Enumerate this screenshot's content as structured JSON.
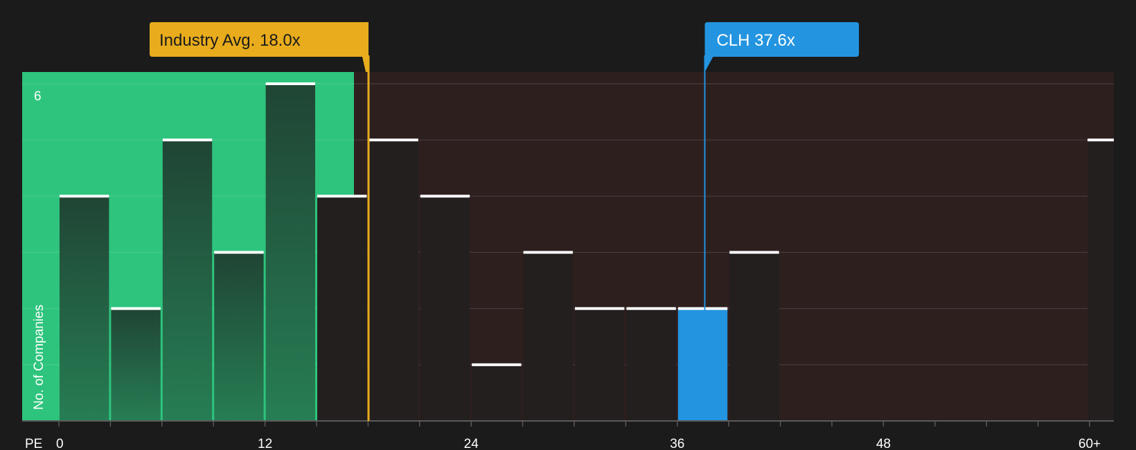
{
  "chart_data": {
    "type": "bar",
    "xlabel": "PE",
    "ylabel": "No. of Companies",
    "x_ticks": [
      "0",
      "12",
      "24",
      "36",
      "48",
      "60+"
    ],
    "y_ticks": [
      "6"
    ],
    "xlim": [
      -2.2,
      61.5
    ],
    "ylim": [
      0,
      6
    ],
    "bin_width": 3,
    "bins": [
      {
        "start": 0,
        "value": 4
      },
      {
        "start": 3,
        "value": 2
      },
      {
        "start": 6,
        "value": 5
      },
      {
        "start": 9,
        "value": 3
      },
      {
        "start": 12,
        "value": 6
      },
      {
        "start": 15,
        "value": 4
      },
      {
        "start": 18,
        "value": 5
      },
      {
        "start": 21,
        "value": 4
      },
      {
        "start": 24,
        "value": 1
      },
      {
        "start": 27,
        "value": 3
      },
      {
        "start": 30,
        "value": 2
      },
      {
        "start": 33,
        "value": 2
      },
      {
        "start": 36,
        "value": 2,
        "highlight": true
      },
      {
        "start": 39,
        "value": 3
      },
      {
        "start": 60,
        "value": 5
      }
    ],
    "industry_avg": {
      "label": "Industry Avg. 18.0x",
      "value": 18.0
    },
    "company": {
      "label": "CLH 37.6x",
      "value": 37.6
    },
    "grid": true
  },
  "colors": {
    "background": "#1b1b1b",
    "green_zone": "#2ec47d",
    "red_zone": "#2e1f1f",
    "bar_green": "#1f5a3c",
    "bar_dark": "#231f1f",
    "bar_highlight": "#2394e0",
    "industry": "#e8ac1c",
    "company": "#2394e0",
    "bar_cap": "#ffffff"
  }
}
